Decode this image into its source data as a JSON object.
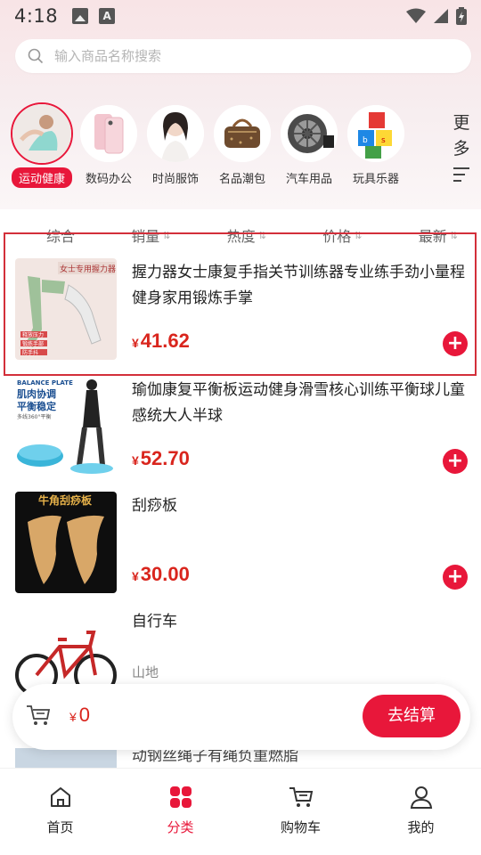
{
  "status_bar": {
    "time": "4:18"
  },
  "search": {
    "placeholder": "输入商品名称搜索"
  },
  "categories": [
    {
      "label": "运动健康",
      "active": true
    },
    {
      "label": "数码办公"
    },
    {
      "label": "时尚服饰"
    },
    {
      "label": "名品潮包"
    },
    {
      "label": "汽车用品"
    },
    {
      "label": "玩具乐器"
    }
  ],
  "more": {
    "line1": "更",
    "line2": "多"
  },
  "sort": [
    {
      "label": "综合"
    },
    {
      "label": "销量",
      "arrow": "⇅"
    },
    {
      "label": "热度",
      "arrow": "⇅"
    },
    {
      "label": "价格",
      "arrow": "⇅"
    },
    {
      "label": "最新",
      "arrow": "⇅"
    }
  ],
  "products": [
    {
      "title": "握力器女士康复手指关节训练器专业练手劲小量程健身家用锻炼手掌",
      "price": "41.62",
      "currency": "¥",
      "thumb_text": "女士专用握力器",
      "thumb_tags": [
        "释放压力",
        "锻炼手部",
        "防手抖"
      ]
    },
    {
      "title": "瑜伽康复平衡板运动健身滑雪核心训练平衡球儿童感统大人半球",
      "price": "52.70",
      "currency": "¥",
      "thumb_text_top": "BALANCE PLATE",
      "thumb_text_main1": "肌肉协调",
      "thumb_text_main2": "平衡稳定",
      "thumb_text_small": "多线360°平衡"
    },
    {
      "title": "刮痧板",
      "price": "30.00",
      "currency": "¥",
      "thumb_text": "牛角刮痧板"
    },
    {
      "title": "自行车",
      "subtitle": "山地"
    },
    {
      "title": "动钢丝绳子有绳负重燃脂"
    }
  ],
  "cart": {
    "currency": "¥",
    "total": "0",
    "checkout_label": "去结算"
  },
  "nav": [
    {
      "label": "首页"
    },
    {
      "label": "分类",
      "active": true
    },
    {
      "label": "购物车"
    },
    {
      "label": "我的"
    }
  ],
  "colors": {
    "accent": "#e8173a",
    "price": "#d9251d"
  }
}
